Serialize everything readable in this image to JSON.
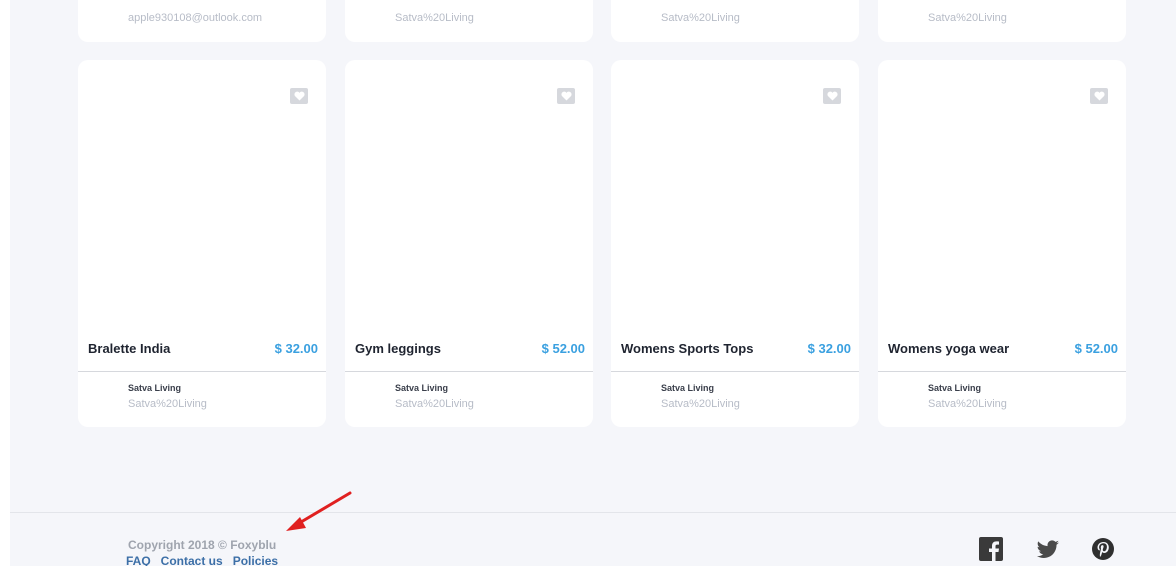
{
  "top_row": [
    {
      "seller_url": "apple930108@outlook.com"
    },
    {
      "seller_url": "Satva%20Living"
    },
    {
      "seller_url": "Satva%20Living"
    },
    {
      "seller_url": "Satva%20Living"
    }
  ],
  "products": [
    {
      "name": "Bralette India",
      "price": "$ 32.00",
      "seller_name": "Satva Living",
      "seller_url": "Satva%20Living"
    },
    {
      "name": "Gym leggings",
      "price": "$ 52.00",
      "seller_name": "Satva Living",
      "seller_url": "Satva%20Living"
    },
    {
      "name": "Womens Sports Tops",
      "price": "$ 32.00",
      "seller_name": "Satva Living",
      "seller_url": "Satva%20Living"
    },
    {
      "name": "Womens yoga wear",
      "price": "$ 52.00",
      "seller_name": "Satva Living",
      "seller_url": "Satva%20Living"
    }
  ],
  "footer": {
    "copyright": "Copyright 2018 © Foxyblu",
    "links": [
      "FAQ",
      "Contact us",
      "Policies"
    ],
    "social_icons": [
      "facebook-icon",
      "twitter-icon",
      "pinterest-icon"
    ]
  },
  "colors": {
    "price": "#3aa0e0",
    "link": "#3c6fa7",
    "arrow": "#e02020",
    "background": "#f5f6fa"
  }
}
